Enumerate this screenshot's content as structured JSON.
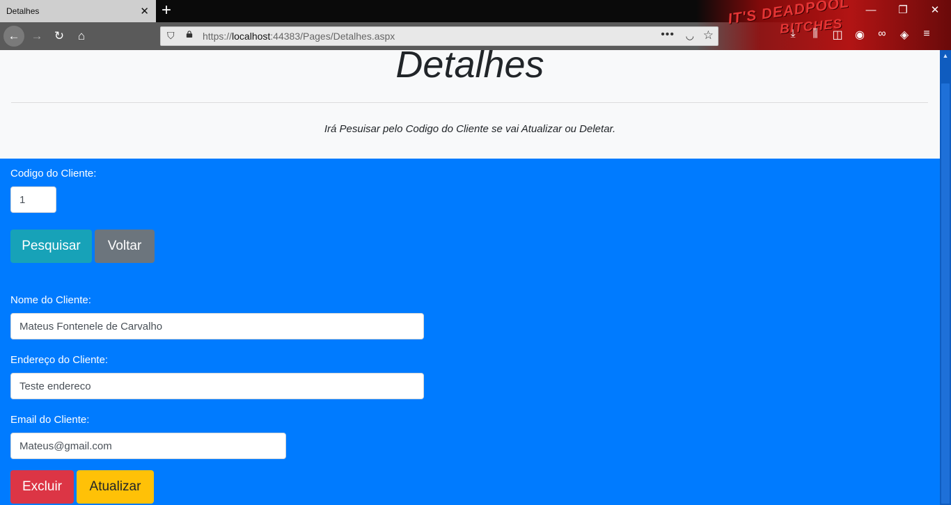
{
  "browser": {
    "tab_title": "Detalhes",
    "tab_close": "✕",
    "new_tab": "+",
    "url_scheme": "https://",
    "url_host": "localhost",
    "url_rest": ":44383/Pages/Detalhes.aspx",
    "theme_text_1": "IT'S DEADPOOL",
    "theme_text_2": "BITCHES",
    "icons": [
      "back-icon",
      "forward-icon",
      "reload-icon",
      "home-icon",
      "shield-icon",
      "lock-icon",
      "more-icon",
      "pocket-icon",
      "star-icon",
      "download-icon",
      "library-icon",
      "sidebar-icon",
      "account-icon",
      "extension-icon",
      "ublock-icon",
      "menu-icon"
    ]
  },
  "page": {
    "title": "Detalhes",
    "subtitle": "Irá Pesuisar pelo Codigo do Cliente se vai Atualizar ou Deletar.",
    "codigo_label": "Codigo do Cliente:",
    "codigo_value": "1",
    "pesquisar_label": "Pesquisar",
    "voltar_label": "Voltar",
    "nome_label": "Nome do Cliente:",
    "nome_value": "Mateus Fontenele de Carvalho",
    "endereco_label": "Endereço do Cliente:",
    "endereco_value": "Teste endereco",
    "email_label": "Email do Cliente:",
    "email_value": "Mateus@gmail.com",
    "excluir_label": "Excluir",
    "atualizar_label": "Atualizar"
  },
  "colors": {
    "page_background": "#007bff",
    "pesquisar": "#17a2b8",
    "voltar": "#6c757d",
    "excluir": "#dc3545",
    "atualizar": "#ffc107"
  }
}
